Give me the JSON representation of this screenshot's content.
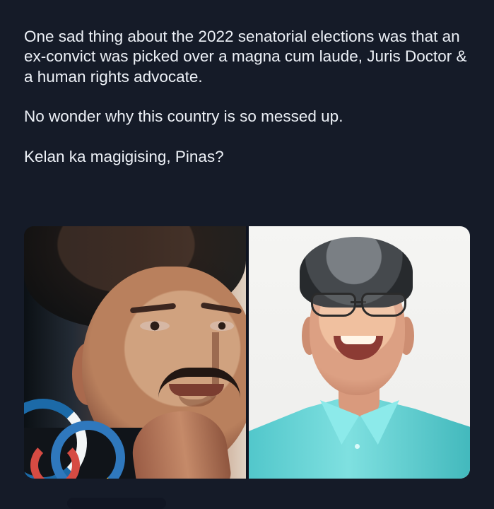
{
  "post": {
    "paragraphs": [
      "One sad thing about the 2022 senatorial elections was that an ex-convict was picked over a magna cum laude, Juris Doctor & a human rights advocate.",
      "No wonder why this country is so messed up.",
      "Kelan ka magigising, Pinas?"
    ]
  },
  "media": {
    "images": [
      {
        "name": "left-portrait",
        "background_color": "#111827"
      },
      {
        "name": "right-portrait",
        "background_color": "#f2f2f0"
      }
    ]
  },
  "colors": {
    "page_background": "#151b28",
    "text": "#edf1f7",
    "shirt": "#5fd2d4"
  }
}
